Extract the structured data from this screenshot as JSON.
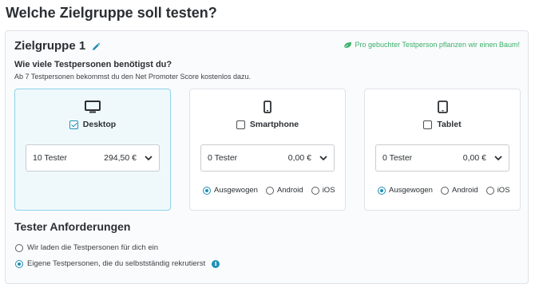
{
  "page": {
    "title": "Welche Zielgruppe soll testen?"
  },
  "group": {
    "title": "Zielgruppe 1",
    "tree_note": "Pro gebuchter Testperson pflanzen wir einen Baum!",
    "question": "Wie viele Testpersonen benötigst du?",
    "nps_note": "Ab 7 Testpersonen bekommst du den Net Promoter Score kostenlos dazu."
  },
  "devices": [
    {
      "label": "Desktop",
      "checked": true,
      "icon": "monitor-icon",
      "tester_count": "10 Tester",
      "price": "294,50 €"
    },
    {
      "label": "Smartphone",
      "checked": false,
      "icon": "smartphone-icon",
      "tester_count": "0 Tester",
      "price": "0,00 €",
      "os_options": [
        "Ausgewogen",
        "Android",
        "iOS"
      ],
      "os_selected": "Ausgewogen"
    },
    {
      "label": "Tablet",
      "checked": false,
      "icon": "tablet-icon",
      "tester_count": "0 Tester",
      "price": "0,00 €",
      "os_options": [
        "Ausgewogen",
        "Android",
        "iOS"
      ],
      "os_selected": "Ausgewogen"
    }
  ],
  "requirements": {
    "title": "Tester Anforderungen",
    "options": [
      {
        "label": "Wir laden die Testpersonen für dich ein",
        "selected": false
      },
      {
        "label": "Eigene Testpersonen, die du selbstständig rekrutierst",
        "selected": true
      }
    ]
  },
  "colors": {
    "accent": "#1f8fb5",
    "selected_card_bg": "#eff9fc",
    "selected_card_border": "#8fd3e8",
    "green_note": "#3ab06b"
  }
}
